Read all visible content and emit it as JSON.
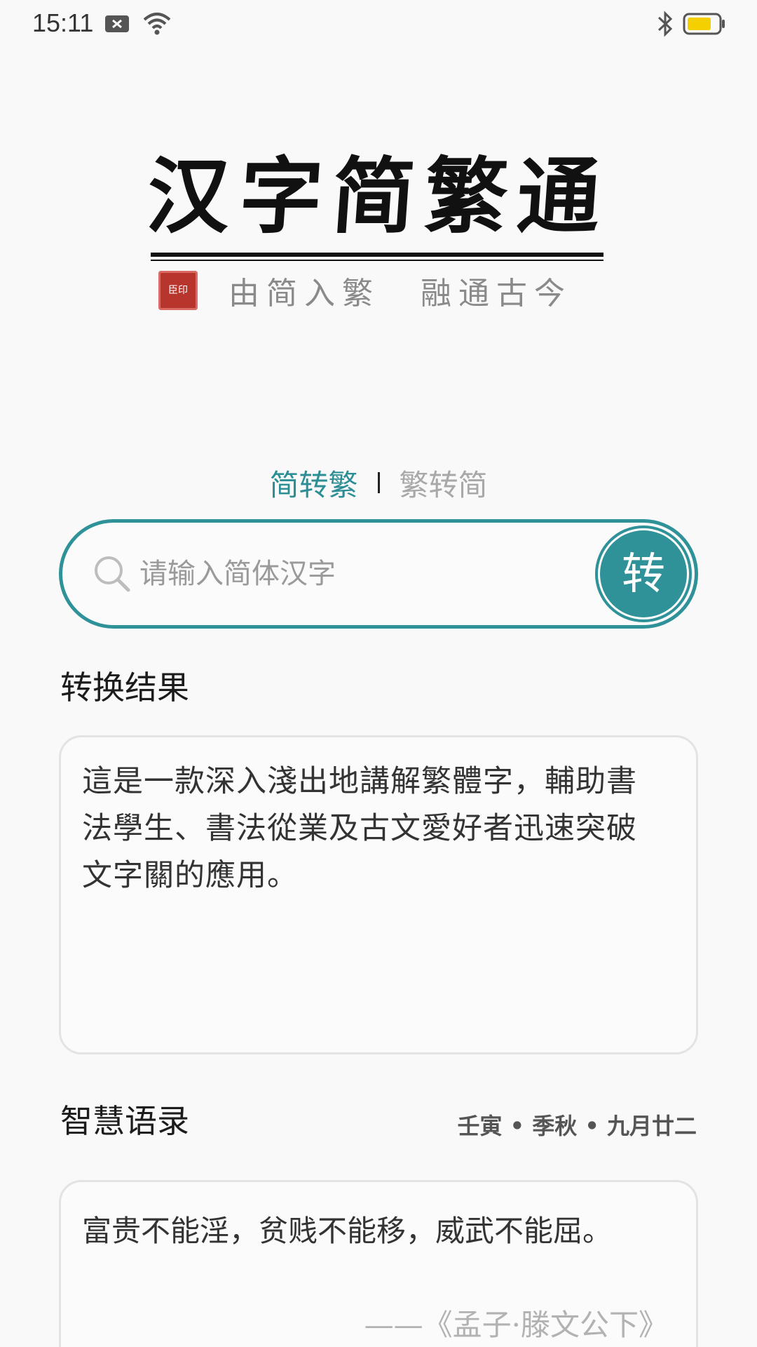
{
  "status_bar": {
    "time": "15:11",
    "icons_left": [
      "notification-x-icon",
      "wifi-icon"
    ],
    "icons_right": [
      "bluetooth-icon",
      "battery-icon"
    ],
    "battery_color": "#f5d000"
  },
  "logo": {
    "title": "汉字简繁通",
    "seal_text": "臣印",
    "slogan_1": "由简入繁",
    "slogan_2": "融通古今"
  },
  "mode": {
    "active": "简转繁",
    "inactive": "繁转简"
  },
  "search": {
    "placeholder": "请输入简体汉字",
    "value": "",
    "button_label": "转"
  },
  "result": {
    "title": "转换结果",
    "text": "這是一款深入淺出地講解繁體字，輔助書法學生、書法從業及古文愛好者迅速突破文字關的應用。"
  },
  "quotes": {
    "title": "智慧语录",
    "lunar_date": "壬寅 • 季秋 • 九月廿二",
    "text": "富贵不能淫，贫贱不能移，威武不能屈。",
    "source": "——《孟子·滕文公下》"
  },
  "colors": {
    "accent": "#2e9298",
    "seal": "#b8352d"
  }
}
